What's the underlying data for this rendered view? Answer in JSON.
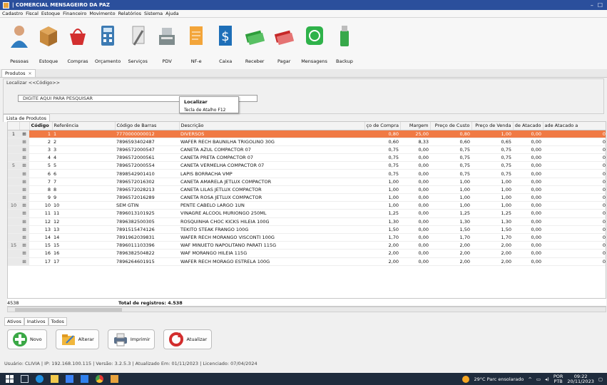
{
  "window": {
    "title": "| COMERCIAL MENSAGEIRO DA PAZ",
    "controls": [
      "–",
      "☐"
    ]
  },
  "menu": [
    "Cadastro",
    "Fiscal",
    "Estoque",
    "Financeiro",
    "Movimento",
    "Relatórios",
    "Sistema",
    "Ajuda"
  ],
  "ribbon": [
    {
      "label": "Pessoas",
      "icon": "person-icon",
      "color": "#2f7cc0"
    },
    {
      "label": "Estoque",
      "icon": "box-icon",
      "color": "#c88a3d"
    },
    {
      "label": "Compras",
      "icon": "basket-icon",
      "color": "#d32f2f"
    },
    {
      "label": "Orçamento",
      "icon": "calculator-icon",
      "color": "#3d7bb3"
    },
    {
      "label": "Serviços",
      "icon": "tools-icon",
      "color": "#9e9e9e"
    },
    {
      "label": "PDV",
      "icon": "register-icon",
      "color": "#7f8c8d"
    },
    {
      "label": "NF-e",
      "icon": "invoice-icon",
      "color": "#f3a53a"
    },
    {
      "label": "Caixa",
      "icon": "cash-icon",
      "color": "#1e6fb8"
    },
    {
      "label": "Receber",
      "icon": "money-in-icon",
      "color": "#2e9d3b"
    },
    {
      "label": "Pagar",
      "icon": "money-out-icon",
      "color": "#c62828"
    },
    {
      "label": "Mensagens",
      "icon": "whatsapp-icon",
      "color": "#2fb24a"
    },
    {
      "label": "Backup",
      "icon": "usb-drive-icon",
      "color": "#37a84a"
    }
  ],
  "tabs": {
    "active": "Produtos"
  },
  "search": {
    "legend": "Localizar <<Código>>",
    "placeholder": "DIGITE AQUI PARA PESQUISAR",
    "tooltip_title": "Localizar",
    "tooltip_hint": "Tecla de Atalho F12"
  },
  "list": {
    "tab_label": "Lista de Produtos",
    "columns": [
      "",
      "",
      "Código",
      "Referência",
      "Código de Barras",
      "Descrição",
      "ço de Compra",
      "Margem",
      "Preço de Custo",
      "Preço de Venda",
      "de Atacado",
      "ade Atacado a"
    ],
    "rows": [
      [
        "1",
        "1",
        "1",
        "7770000000012",
        "DIVERSOS",
        "0,80",
        "25,00",
        "0,80",
        "1,00",
        "0,00",
        "0"
      ],
      [
        "",
        "2",
        "2",
        "7896593402487",
        "WAFER RECH BAUNILHA TRIGOLINO 30G",
        "0,60",
        "8,33",
        "0,60",
        "0,65",
        "0,00",
        "0"
      ],
      [
        "",
        "3",
        "3",
        "7896572000547",
        "CANETA AZUL COMPACTOR 07",
        "0,75",
        "0,00",
        "0,75",
        "0,75",
        "0,00",
        "0"
      ],
      [
        "",
        "4",
        "4",
        "7896572000561",
        "CANETA PRETA COMPACTOR 07",
        "0,75",
        "0,00",
        "0,75",
        "0,75",
        "0,00",
        "0"
      ],
      [
        "5",
        "5",
        "5",
        "7896572000554",
        "CANETA VERMELHA COMPACTOR 07",
        "0,75",
        "0,00",
        "0,75",
        "0,75",
        "0,00",
        "0"
      ],
      [
        "",
        "6",
        "6",
        "7898542901410",
        "LAPIS BORRACHA VMP",
        "0,75",
        "0,00",
        "0,75",
        "0,75",
        "0,00",
        "0"
      ],
      [
        "",
        "7",
        "7",
        "7896572016302",
        "CANETA AMARELA JETLUX COMPACTOR",
        "1,00",
        "0,00",
        "1,00",
        "1,00",
        "0,00",
        "0"
      ],
      [
        "",
        "8",
        "8",
        "7896572028213",
        "CANETA LILAS JETLUX COMPACTOR",
        "1,00",
        "0,00",
        "1,00",
        "1,00",
        "0,00",
        "0"
      ],
      [
        "",
        "9",
        "9",
        "7896572016289",
        "CANETA ROSA JETLUX COMPACTOR",
        "1,00",
        "0,00",
        "1,00",
        "1,00",
        "0,00",
        "0"
      ],
      [
        "10",
        "10",
        "10",
        "SEM GTIN",
        "PENTE CABELO LARGO 1UN",
        "1,00",
        "0,00",
        "1,00",
        "1,00",
        "0,00",
        "0"
      ],
      [
        "",
        "11",
        "11",
        "7896013101925",
        "VINAGRE ALCOOL MURIONGO 250ML",
        "1,25",
        "0,00",
        "1,25",
        "1,25",
        "0,00",
        "0"
      ],
      [
        "",
        "12",
        "12",
        "7896382500305",
        "ROSQUINHA CHOC KICKS HILEIA 100G",
        "1,30",
        "0,00",
        "1,30",
        "1,30",
        "0,00",
        "0"
      ],
      [
        "",
        "13",
        "13",
        "7891515474126",
        "TEKITO STEAK FRANGO 100G",
        "1,50",
        "0,00",
        "1,50",
        "1,50",
        "0,00",
        "0"
      ],
      [
        "",
        "14",
        "14",
        "7891962039831",
        "WAFER RECH MORANGO VISCONTI 100G",
        "1,70",
        "0,00",
        "1,70",
        "1,70",
        "0,00",
        "0"
      ],
      [
        "15",
        "15",
        "15",
        "7896011103396",
        "WAF MINUETO NAPOLITANO PARATI 115G",
        "2,00",
        "0,00",
        "2,00",
        "2,00",
        "0,00",
        "0"
      ],
      [
        "",
        "16",
        "16",
        "7896382504822",
        "WAF MORANGO HILEIA 115G",
        "2,00",
        "0,00",
        "2,00",
        "2,00",
        "0,00",
        "0"
      ],
      [
        "",
        "17",
        "17",
        "7896264601915",
        "WAFER RECH MORAGO ESTRELA 100G",
        "2,00",
        "0,00",
        "2,00",
        "2,00",
        "0,00",
        "0"
      ]
    ],
    "count": "4538",
    "total_label": "Total de registros: 4.538"
  },
  "filters": [
    "Ativos",
    "Inativos",
    "Todos"
  ],
  "actions": [
    {
      "label": "Novo",
      "icon": "plus-icon",
      "color": "#3aa845"
    },
    {
      "label": "Alterar",
      "icon": "edit-folder-icon",
      "color": "#f0b63c"
    },
    {
      "label": "Imprimir",
      "icon": "printer-icon",
      "color": "#5a6f8a"
    },
    {
      "label": "Atualizar",
      "icon": "refresh-icon",
      "color": "#d22d2d"
    }
  ],
  "status": "Usuário: CLIVIA | IP: 192.168.100.115 | Versão: 3.2.5.3 | Atualizado Em: 01/11/2023 | Licenciado: 07/04/2024",
  "taskbar": {
    "weather": "29°C Parc ensolarado",
    "lang": "POR",
    "lang2": "PTB",
    "time": "09:22",
    "date": "20/11/2023"
  },
  "colors": {
    "selected_row": "#f07a44",
    "titlebar": "#2b4f9c",
    "taskbar": "#1f2c3d"
  }
}
